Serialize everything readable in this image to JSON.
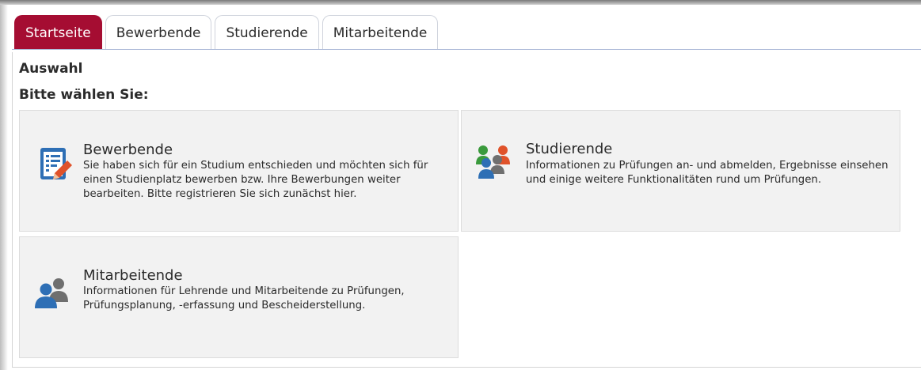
{
  "tabs": [
    {
      "label": "Startseite",
      "active": true
    },
    {
      "label": "Bewerbende",
      "active": false
    },
    {
      "label": "Studierende",
      "active": false
    },
    {
      "label": "Mitarbeitende",
      "active": false
    }
  ],
  "main": {
    "heading": "Auswahl",
    "subheading": "Bitte wählen Sie:",
    "cards": [
      {
        "title": "Bewerbende",
        "description": "Sie haben sich für ein Studium entschieden und möchten sich für einen Studienplatz bewerben bzw. Ihre Bewerbungen weiter bearbeiten. Bitte registrieren Sie sich zunächst hier.",
        "icon": "application-form-icon"
      },
      {
        "title": "Studierende",
        "description": "Informationen zu Prüfungen an- und abmelden, Ergebnisse einsehen und einige weitere Funktionalitäten rund um Prüfungen.",
        "icon": "students-group-icon"
      },
      {
        "title": "Mitarbeitende",
        "description": "Informationen für Lehrende und Mitarbeitende zu Prüfungen, Prüfungsplanung, -erfassung und Bescheiderstellung.",
        "icon": "staff-group-icon"
      }
    ]
  },
  "colors": {
    "active_tab": "#a50d32",
    "card_background": "#f2f2f2",
    "icon_blue": "#2e6fb5",
    "icon_orange": "#e0522a",
    "icon_green": "#3a9a3c",
    "icon_gray": "#6f6f6f"
  }
}
